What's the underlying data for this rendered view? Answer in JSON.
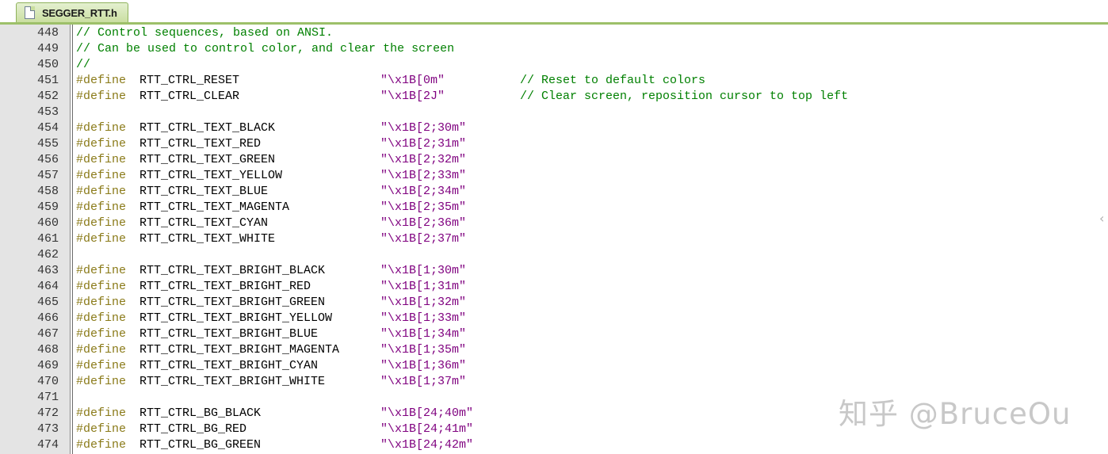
{
  "tab": {
    "title": "SEGGER_RTT.h"
  },
  "lines": [
    {
      "num": "448",
      "comment": "// Control sequences, based on ANSI."
    },
    {
      "num": "449",
      "comment": "// Can be used to control color, and clear the screen"
    },
    {
      "num": "450",
      "comment": "//"
    },
    {
      "num": "451",
      "kw": "#define",
      "name": "RTT_CTRL_RESET",
      "str": "\"\\x1B[0m\"",
      "comment": "// Reset to default colors"
    },
    {
      "num": "452",
      "kw": "#define",
      "name": "RTT_CTRL_CLEAR",
      "str": "\"\\x1B[2J\"",
      "comment": "// Clear screen, reposition cursor to top left"
    },
    {
      "num": "453"
    },
    {
      "num": "454",
      "kw": "#define",
      "name": "RTT_CTRL_TEXT_BLACK",
      "str": "\"\\x1B[2;30m\""
    },
    {
      "num": "455",
      "kw": "#define",
      "name": "RTT_CTRL_TEXT_RED",
      "str": "\"\\x1B[2;31m\""
    },
    {
      "num": "456",
      "kw": "#define",
      "name": "RTT_CTRL_TEXT_GREEN",
      "str": "\"\\x1B[2;32m\""
    },
    {
      "num": "457",
      "kw": "#define",
      "name": "RTT_CTRL_TEXT_YELLOW",
      "str": "\"\\x1B[2;33m\""
    },
    {
      "num": "458",
      "kw": "#define",
      "name": "RTT_CTRL_TEXT_BLUE",
      "str": "\"\\x1B[2;34m\""
    },
    {
      "num": "459",
      "kw": "#define",
      "name": "RTT_CTRL_TEXT_MAGENTA",
      "str": "\"\\x1B[2;35m\""
    },
    {
      "num": "460",
      "kw": "#define",
      "name": "RTT_CTRL_TEXT_CYAN",
      "str": "\"\\x1B[2;36m\""
    },
    {
      "num": "461",
      "kw": "#define",
      "name": "RTT_CTRL_TEXT_WHITE",
      "str": "\"\\x1B[2;37m\""
    },
    {
      "num": "462"
    },
    {
      "num": "463",
      "kw": "#define",
      "name": "RTT_CTRL_TEXT_BRIGHT_BLACK",
      "str": "\"\\x1B[1;30m\""
    },
    {
      "num": "464",
      "kw": "#define",
      "name": "RTT_CTRL_TEXT_BRIGHT_RED",
      "str": "\"\\x1B[1;31m\""
    },
    {
      "num": "465",
      "kw": "#define",
      "name": "RTT_CTRL_TEXT_BRIGHT_GREEN",
      "str": "\"\\x1B[1;32m\""
    },
    {
      "num": "466",
      "kw": "#define",
      "name": "RTT_CTRL_TEXT_BRIGHT_YELLOW",
      "str": "\"\\x1B[1;33m\""
    },
    {
      "num": "467",
      "kw": "#define",
      "name": "RTT_CTRL_TEXT_BRIGHT_BLUE",
      "str": "\"\\x1B[1;34m\""
    },
    {
      "num": "468",
      "kw": "#define",
      "name": "RTT_CTRL_TEXT_BRIGHT_MAGENTA",
      "str": "\"\\x1B[1;35m\""
    },
    {
      "num": "469",
      "kw": "#define",
      "name": "RTT_CTRL_TEXT_BRIGHT_CYAN",
      "str": "\"\\x1B[1;36m\""
    },
    {
      "num": "470",
      "kw": "#define",
      "name": "RTT_CTRL_TEXT_BRIGHT_WHITE",
      "str": "\"\\x1B[1;37m\""
    },
    {
      "num": "471"
    },
    {
      "num": "472",
      "kw": "#define",
      "name": "RTT_CTRL_BG_BLACK",
      "str": "\"\\x1B[24;40m\""
    },
    {
      "num": "473",
      "kw": "#define",
      "name": "RTT_CTRL_BG_RED",
      "str": "\"\\x1B[24;41m\""
    },
    {
      "num": "474",
      "kw": "#define",
      "name": "RTT_CTRL_BG_GREEN",
      "str": "\"\\x1B[24;42m\""
    }
  ],
  "watermark": "知乎 @BruceOu",
  "colors": {
    "keyword": "#8a7a18",
    "string": "#7f007f",
    "comment": "#008000",
    "gutter": "#e4e4e4",
    "tab_accent": "#9dc06a"
  }
}
